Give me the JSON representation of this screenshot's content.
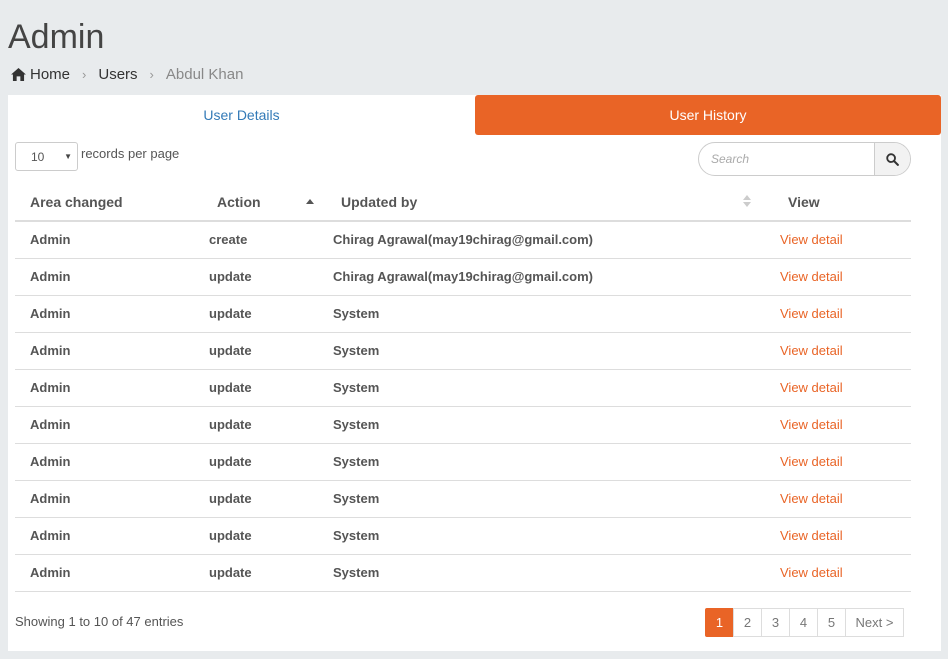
{
  "page": {
    "title": "Admin"
  },
  "breadcrumb": {
    "home": "Home",
    "users": "Users",
    "current": "Abdul Khan",
    "separator": "›"
  },
  "tabs": {
    "details": "User Details",
    "history": "User History"
  },
  "length": {
    "value": "10",
    "label": "records per page"
  },
  "search": {
    "placeholder": "Search"
  },
  "table": {
    "headers": {
      "area": "Area changed",
      "action": "Action",
      "updated_by": "Updated by",
      "view": "View"
    },
    "rows": [
      {
        "area": "Admin",
        "action": "create",
        "updated_by": "Chirag Agrawal(may19chirag@gmail.com)",
        "view": "View detail"
      },
      {
        "area": "Admin",
        "action": "update",
        "updated_by": "Chirag Agrawal(may19chirag@gmail.com)",
        "view": "View detail"
      },
      {
        "area": "Admin",
        "action": "update",
        "updated_by": "System",
        "view": "View detail"
      },
      {
        "area": "Admin",
        "action": "update",
        "updated_by": "System",
        "view": "View detail"
      },
      {
        "area": "Admin",
        "action": "update",
        "updated_by": "System",
        "view": "View detail"
      },
      {
        "area": "Admin",
        "action": "update",
        "updated_by": "System",
        "view": "View detail"
      },
      {
        "area": "Admin",
        "action": "update",
        "updated_by": "System",
        "view": "View detail"
      },
      {
        "area": "Admin",
        "action": "update",
        "updated_by": "System",
        "view": "View detail"
      },
      {
        "area": "Admin",
        "action": "update",
        "updated_by": "System",
        "view": "View detail"
      },
      {
        "area": "Admin",
        "action": "update",
        "updated_by": "System",
        "view": "View detail"
      }
    ]
  },
  "info": "Showing 1 to 10 of 47 entries",
  "pagination": {
    "pages": [
      "1",
      "2",
      "3",
      "4",
      "5"
    ],
    "active": "1",
    "next": "Next >"
  },
  "colors": {
    "accent": "#e96426",
    "link": "#337ab7",
    "background": "#e8ebed"
  }
}
